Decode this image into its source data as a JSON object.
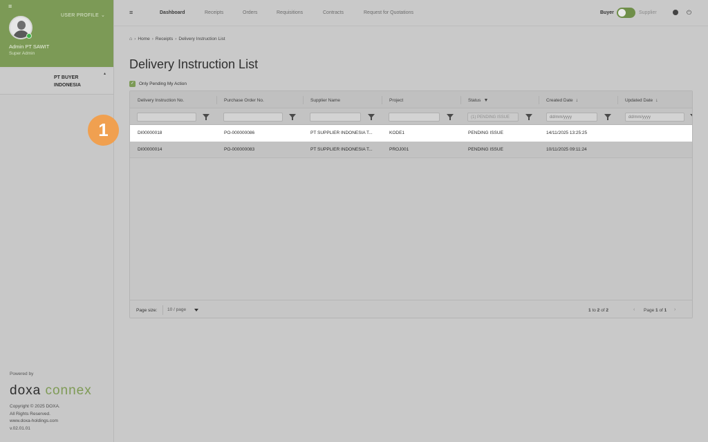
{
  "sidebar": {
    "menu_icon": "≡",
    "user_profile_label": "USER PROFILE",
    "user_name": "Admin PT SAWIT",
    "user_role": "Super Admin",
    "company_name": "PT BUYER INDONESIA",
    "powered_by": "Powered by",
    "logo_doxa": "doxa",
    "logo_connex": "connex",
    "copyright": "Copyright © 2025 DOXA.",
    "rights": "All Rights Reserved.",
    "website": "www.doxa-holdings.com",
    "version": "v.02.01.01"
  },
  "topnav": {
    "menu_icon": "≡",
    "items": [
      "Dashboard",
      "Receipts",
      "Orders",
      "Requisitions",
      "Contracts",
      "Request for Quotations"
    ],
    "active_item": "Dashboard",
    "role_buyer": "Buyer",
    "role_supplier": "Supplier",
    "toggle_on": true
  },
  "breadcrumb": {
    "home_icon": "home-icon",
    "items": [
      "Home",
      "Receipts",
      "Delivery Instruction List"
    ]
  },
  "page": {
    "title": "Delivery Instruction List",
    "pending_checked": true,
    "pending_label": "Only Pending My Action"
  },
  "grid": {
    "columns": [
      "Delivery Instruction No.",
      "Purchase Order No.",
      "Supplier Name",
      "Project",
      "Status",
      "Created Date",
      "Updated Date"
    ],
    "filters": {
      "status_placeholder": "(1) PENDING ISSUE",
      "created_placeholder": "dd/mm/yyyy",
      "updated_placeholder": "dd/mm/yyyy"
    },
    "rows": [
      [
        "DI00000018",
        "PO-000000086",
        "PT SUPPLIER INDONESIA T...",
        "KODE1",
        "PENDING ISSUE",
        "14/11/2025 13:25:25",
        ""
      ],
      [
        "DI00000014",
        "PO-000000083",
        "PT SUPPLIER INDONESIA T...",
        "PROJ001",
        "PENDING ISSUE",
        "10/11/2025 09:11:24",
        ""
      ]
    ],
    "page_size_label": "Page size:",
    "page_size_value": "10 / page",
    "range_prefix": "1",
    "range_to": "to",
    "range_end": "2",
    "range_of": "of",
    "range_total": "2",
    "page_word": "Page",
    "page_current": "1",
    "page_of": "of",
    "page_total": "1"
  },
  "annotation": {
    "step_number": "1"
  },
  "colors": {
    "brand_green": "#7c9a56",
    "step_badge": "#f0a050",
    "highlight_row": "#ffffff"
  }
}
